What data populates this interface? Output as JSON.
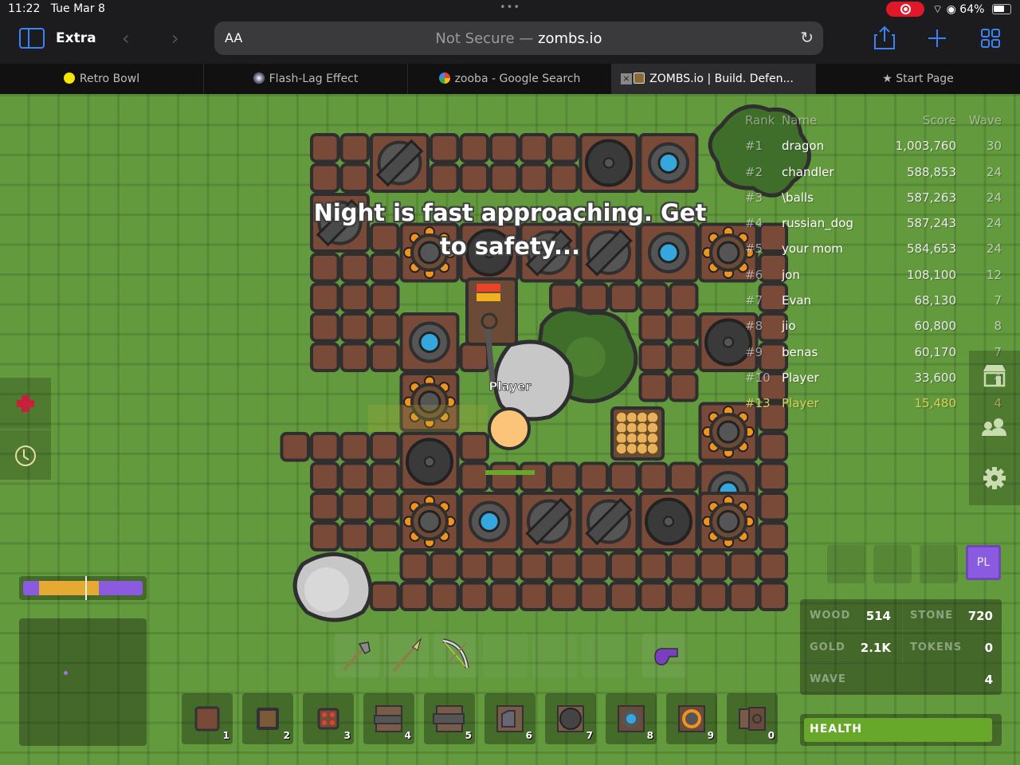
{
  "status_bar": {
    "time": "11:22",
    "date": "Tue Mar 8",
    "battery": "64%",
    "battery_level": 0.64
  },
  "toolbar": {
    "profile": "Extra",
    "text_size": "AA",
    "url_prefix": "Not Secure —",
    "url_domain": "zombs.io"
  },
  "tabs": [
    {
      "label": "Retro Bowl",
      "icon": "pacman-icon",
      "active": false
    },
    {
      "label": "Flash-Lag Effect",
      "icon": "spiral-icon",
      "active": false
    },
    {
      "label": "zooba - Google Search",
      "icon": "google-icon",
      "active": false
    },
    {
      "label": "ZOMBS.io | Build. Defen...",
      "icon": "zombs-icon",
      "active": true
    },
    {
      "label": "Start Page",
      "icon": "star-icon",
      "active": false
    }
  ],
  "game": {
    "announcement": "Night is fast approaching. Get to safety...",
    "player_name": "Player",
    "player_health_fraction": 1.0,
    "leaderboard": {
      "headers": {
        "rank": "Rank",
        "name": "Name",
        "score": "Score",
        "wave": "Wave"
      },
      "rows": [
        {
          "rank": "#1",
          "name": "dragon",
          "score": "1,003,760",
          "wave": "30"
        },
        {
          "rank": "#2",
          "name": "chandler",
          "score": "588,853",
          "wave": "24"
        },
        {
          "rank": "#3",
          "name": "\\balls",
          "score": "587,263",
          "wave": "24"
        },
        {
          "rank": "#4",
          "name": "russian_dog",
          "score": "587,243",
          "wave": "24"
        },
        {
          "rank": "#5",
          "name": "your mom",
          "score": "584,653",
          "wave": "24"
        },
        {
          "rank": "#6",
          "name": "jon",
          "score": "108,100",
          "wave": "12"
        },
        {
          "rank": "#7",
          "name": "Evan",
          "score": "68,130",
          "wave": "7"
        },
        {
          "rank": "#8",
          "name": "jio",
          "score": "60,800",
          "wave": "8"
        },
        {
          "rank": "#9",
          "name": "benas",
          "score": "60,170",
          "wave": "7"
        },
        {
          "rank": "#10",
          "name": "Player",
          "score": "33,600",
          "wave": "4"
        },
        {
          "rank": "#13",
          "name": "Player",
          "score": "15,480",
          "wave": "4",
          "self": true
        }
      ]
    },
    "resources": {
      "wood_label": "WOOD",
      "wood": "514",
      "stone_label": "STONE",
      "stone": "720",
      "gold_label": "GOLD",
      "gold": "2.1K",
      "tokens_label": "TOKENS",
      "tokens": "0",
      "wave_label": "WAVE",
      "wave": "4"
    },
    "health_label": "HEALTH",
    "health_fraction": 0.97,
    "day_night_progress": 0.52,
    "party_label": "PL",
    "left_buttons": [
      "health-potion-icon",
      "clock-icon"
    ],
    "right_buttons": [
      "shop-icon",
      "party-icon",
      "settings-icon"
    ],
    "tools": [
      "pickaxe-icon",
      "spear-icon",
      "bow-icon",
      "",
      "",
      "",
      "",
      "bomb-icon"
    ],
    "build_slots": [
      {
        "key": "1",
        "name": "wall"
      },
      {
        "key": "2",
        "name": "door"
      },
      {
        "key": "3",
        "name": "slow-trap"
      },
      {
        "key": "4",
        "name": "arrow-tower"
      },
      {
        "key": "5",
        "name": "cannon-tower"
      },
      {
        "key": "6",
        "name": "melee-tower"
      },
      {
        "key": "7",
        "name": "bomb-tower"
      },
      {
        "key": "8",
        "name": "mage-tower"
      },
      {
        "key": "9",
        "name": "gold-mine"
      },
      {
        "key": "0",
        "name": "harvester"
      }
    ],
    "colors": {
      "grass": "#639a3e",
      "wall": "#7a4a38",
      "outline": "#2f2f2f",
      "mage": "#35a7df",
      "mine": "#f0941e",
      "health": "#67a82a",
      "purple": "#8a5be0",
      "gold": "#e6a932"
    }
  }
}
